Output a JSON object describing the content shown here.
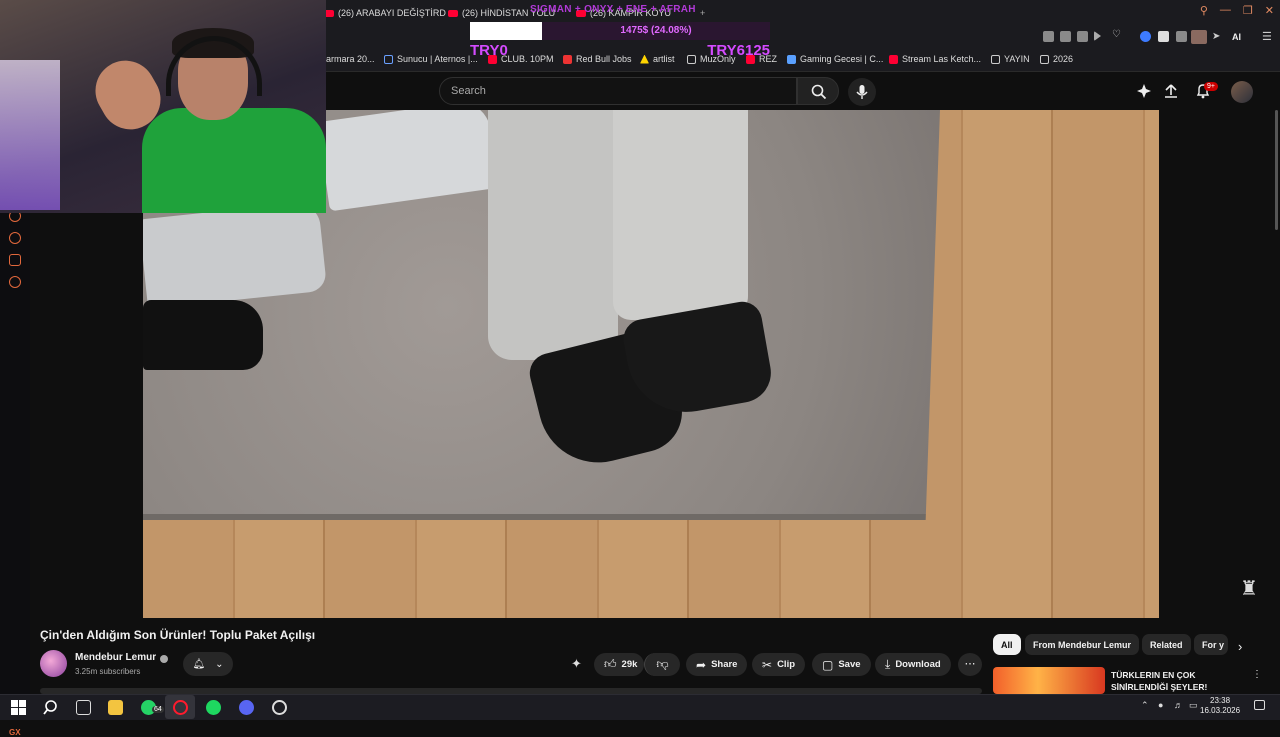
{
  "browser": {
    "tabs": [
      {
        "label": "(26) ARABAYI DEĞİŞTİRD"
      },
      {
        "label": "(26) HİNDİSTAN YOLU"
      },
      {
        "label": "(26) KAMPİR KÖYÜ"
      }
    ],
    "bookmarks": [
      {
        "label": "armara 20...",
        "icon": "bookmark-icon"
      },
      {
        "label": "Sunucu | Aternos |...",
        "icon": "aternos-icon"
      },
      {
        "label": "CLUB. 10PM",
        "icon": "youtube-icon"
      },
      {
        "label": "Red Bull Jobs",
        "icon": "redbull-icon"
      },
      {
        "label": "artlist",
        "icon": "artlist-icon"
      },
      {
        "label": "MuzOnly",
        "icon": "page-icon"
      },
      {
        "label": "REZ",
        "icon": "youtube-icon"
      },
      {
        "label": "Gaming Gecesi | C...",
        "icon": "chart-icon"
      },
      {
        "label": "Stream Las Ketch...",
        "icon": "youtube-icon"
      },
      {
        "label": "YAYIN",
        "icon": "folder-icon"
      },
      {
        "label": "2026",
        "icon": "folder-icon"
      }
    ],
    "ai_label": "AI"
  },
  "overlay": {
    "title": "SIGMAN + ONYX + ENE + AFRAH",
    "progress_text": "1475$ (24.08%)",
    "progress_fraction": 0.2408,
    "left_label": "TRY0",
    "right_label": "TRY6125"
  },
  "header": {
    "search_placeholder": "Search",
    "notification_badge": "9+"
  },
  "video": {
    "title": "Çin'den Aldığım Son Ürünler! Toplu Paket Açılışı",
    "channel_name": "Mendebur Lemur",
    "subscribers": "3.25m subscribers",
    "actions": {
      "likes": "29k",
      "share": "Share",
      "clip": "Clip",
      "save": "Save",
      "download": "Download"
    }
  },
  "chips": [
    "All",
    "From Mendebur Lemur",
    "Related",
    "For y"
  ],
  "recommended": {
    "title": "TÜRKLERIN EN ÇOK SİNİRLENDİĞİ ŞEYLER!"
  },
  "taskbar": {
    "whatsapp_badge": "64",
    "time": "23:38",
    "date": "16.03.2026"
  },
  "sidebar": {
    "gx_label": "GX"
  },
  "colors": {
    "accent": "#e2683c",
    "youtube_red": "#ff0033",
    "overlay_purple": "#d44bff"
  }
}
